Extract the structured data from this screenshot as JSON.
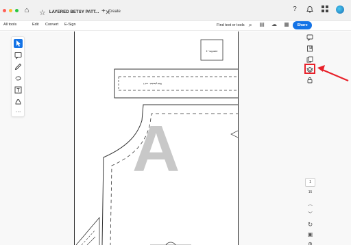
{
  "browser": {
    "tab_title": "LAYERED BETSY PATT...",
    "new_tab_label": "Create"
  },
  "menu": {
    "all_tools": "All tools",
    "edit": "Edit",
    "convert": "Convert",
    "esign": "E-Sign",
    "find_label": "Find text or tools",
    "share_label": "Share"
  },
  "document": {
    "square_label": "1\" square",
    "strip_label": "Skirt placket - cut 1",
    "piece_letter": "A"
  },
  "page_nav": {
    "current_page": "1",
    "total_pages": "15"
  },
  "colors": {
    "accent": "#1473e6",
    "highlight": "#e8212a"
  }
}
